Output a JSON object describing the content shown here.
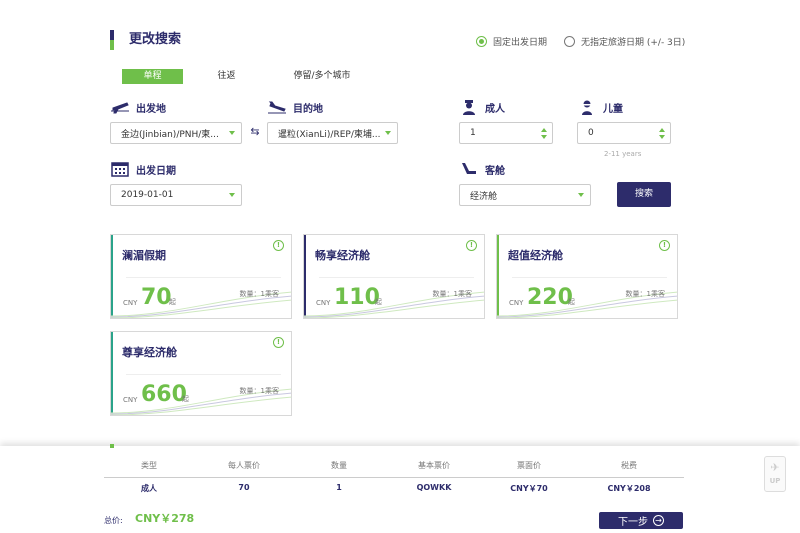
{
  "header": {
    "title": "更改搜索",
    "date_options": [
      {
        "label": "固定出发日期",
        "checked": true
      },
      {
        "label": "无指定旅游日期 (+/- 3日)",
        "checked": false
      }
    ]
  },
  "trip_tabs": [
    {
      "label": "单程",
      "active": true
    },
    {
      "label": "往返",
      "active": false
    },
    {
      "label": "停留/多个城市",
      "active": false
    }
  ],
  "search": {
    "origin_label": "出发地",
    "origin_value": "金边(Jinbian)/PNH/柬...",
    "destination_label": "目的地",
    "destination_value": "暹粒(XianLi)/REP/柬埔...",
    "adult_label": "成人",
    "adult_value": "1",
    "child_label": "儿童",
    "child_value": "0",
    "child_hint": "2-11 years",
    "date_label": "出发日期",
    "date_value": "2019-01-01",
    "cabin_label": "客舱",
    "cabin_value": "经济舱",
    "search_button": "搜索"
  },
  "fares": [
    {
      "name": "澜湄假期",
      "currency": "CNY",
      "price": "70",
      "qi": "起",
      "qty": "数量：1乘客",
      "stripe": "#2aa38a"
    },
    {
      "name": "畅享经济舱",
      "currency": "CNY",
      "price": "110",
      "qi": "起",
      "qty": "数量：1乘客",
      "stripe": "#2d2c6b"
    },
    {
      "name": "超值经济舱",
      "currency": "CNY",
      "price": "220",
      "qi": "起",
      "qty": "数量：1乘客",
      "stripe": "#6fbf4a"
    },
    {
      "name": "尊享经济舱",
      "currency": "CNY",
      "price": "660",
      "qi": "起",
      "qty": "数量：1乘客",
      "stripe": "#2aa38a"
    }
  ],
  "summary": {
    "headers": [
      "类型",
      "每人票价",
      "数量",
      "基本票价",
      "票面价",
      "税费"
    ],
    "row": [
      "成人",
      "70",
      "1",
      "QOWKK",
      "CNY￥70",
      "CNY￥208"
    ],
    "total_label": "总价:",
    "total_value": "CNY￥278",
    "next_button": "下一步",
    "up_label": "UP"
  },
  "colors": {
    "navy": "#2d2c6b",
    "green": "#6fbf4a",
    "teal": "#2aa38a"
  }
}
